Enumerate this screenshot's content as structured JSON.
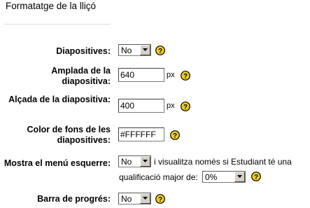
{
  "section": {
    "title": "Formatatge de la lliçó"
  },
  "fields": {
    "slides": {
      "label": "Diapositives:",
      "value": "No"
    },
    "slide_width": {
      "label": "Amplada de la diapositiva:",
      "value": "640",
      "unit": "px"
    },
    "slide_height": {
      "label": "Alçada de la diapositiva:",
      "value": "400",
      "unit": "px"
    },
    "bg_color": {
      "label": "Color de fons de les diapositives:",
      "value": "#FFFFFF"
    },
    "left_menu": {
      "label": "Mostra el menú esquerre:",
      "value": "No",
      "text_before": "i visualitza només si Estudiant té una",
      "text_after": "qualificació major de:",
      "grade_value": "0%"
    },
    "progress_bar": {
      "label": "Barra de progrés:",
      "value": "No"
    }
  },
  "icons": {
    "help": "help-icon",
    "dropdown": "chevron-down-icon"
  },
  "colors": {
    "help_fill": "#f2cf1a",
    "help_stroke": "#000000",
    "control_face": "#d4d0c8"
  }
}
